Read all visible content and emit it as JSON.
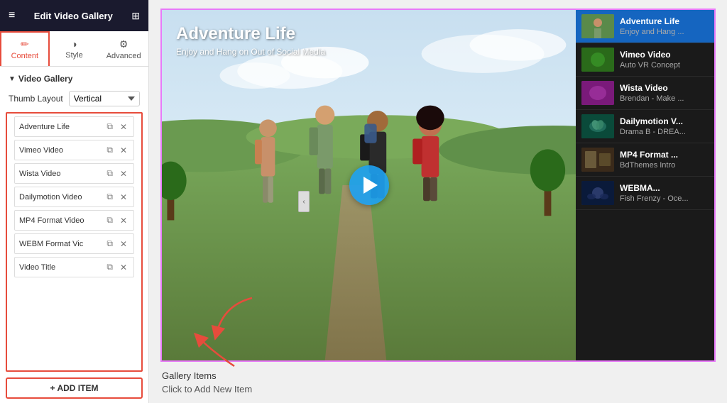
{
  "header": {
    "title": "Edit Video Gallery",
    "menu_icon": "≡",
    "grid_icon": "⊞"
  },
  "tabs": [
    {
      "label": "Content",
      "icon": "✏",
      "active": true
    },
    {
      "label": "Style",
      "icon": "◑",
      "active": false
    },
    {
      "label": "Advanced",
      "icon": "⚙",
      "active": false
    }
  ],
  "section": {
    "title": "Video Gallery",
    "thumb_layout_label": "Thumb Layout",
    "thumb_layout_value": "Vertical"
  },
  "gallery_items": [
    {
      "label": "Adventure Life"
    },
    {
      "label": "Vimeo Video"
    },
    {
      "label": "Wista Video"
    },
    {
      "label": "Dailymotion Video"
    },
    {
      "label": "MP4 Format Video"
    },
    {
      "label": "WEBM Format Vic"
    },
    {
      "label": "Video Title"
    }
  ],
  "add_item_btn": "+ ADD ITEM",
  "gallery_items_label": "Gallery Items",
  "click_to_add_label": "Click to Add New Item",
  "video": {
    "title": "Adventure Life",
    "subtitle": "Enjoy and Hang on Out of Social Media"
  },
  "thumbnails": [
    {
      "title": "Adventure Life",
      "subtitle": "Enjoy and Hang ...",
      "active": true,
      "style": "adventure"
    },
    {
      "title": "Vimeo Video",
      "subtitle": "Auto VR Concept",
      "active": false,
      "style": "vimeo"
    },
    {
      "title": "Wista Video",
      "subtitle": "Brendan - Make ...",
      "active": false,
      "style": "wista"
    },
    {
      "title": "Dailymotion V...",
      "subtitle": "Drama B - DREA...",
      "active": false,
      "style": "dailymotion"
    },
    {
      "title": "MP4 Format ...",
      "subtitle": "BdThemes Intro",
      "active": false,
      "style": "mp4"
    },
    {
      "title": "WEBMA...",
      "subtitle": "Fish Frenzy - Oce...",
      "active": false,
      "style": "webm"
    }
  ],
  "colors": {
    "accent": "#e74c3c",
    "header_bg": "#1a1a2e",
    "active_tab_border": "#e74c3c",
    "thumb_active_bg": "#1565c0",
    "gallery_border": "#e879f9",
    "play_btn": "#1da1f2"
  }
}
